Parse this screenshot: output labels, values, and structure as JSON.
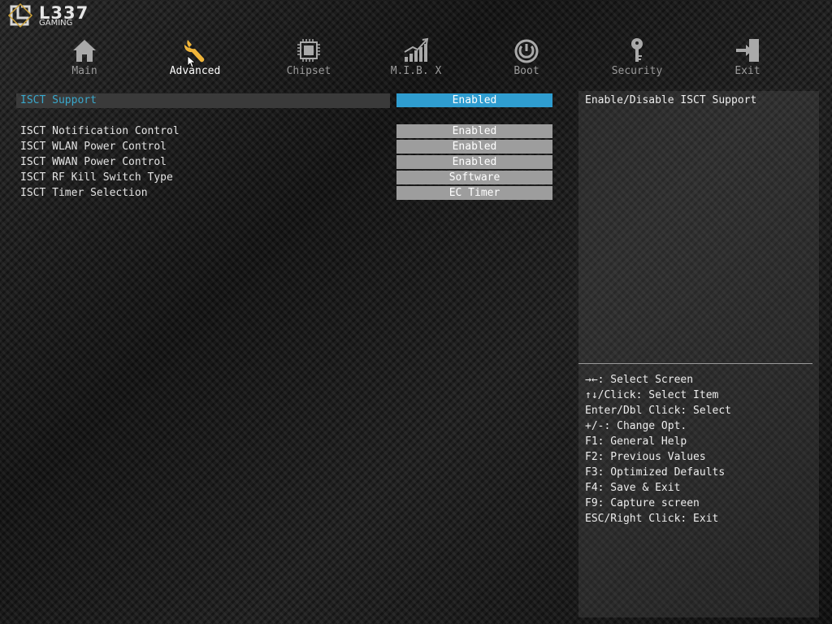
{
  "logo": {
    "brand": "L337",
    "sub": "GAMING"
  },
  "tabs": [
    {
      "label": "Main",
      "icon": "home-icon"
    },
    {
      "label": "Advanced",
      "icon": "wrench-icon",
      "active": true
    },
    {
      "label": "Chipset",
      "icon": "chip-icon"
    },
    {
      "label": "M.I.B. X",
      "icon": "chart-icon"
    },
    {
      "label": "Boot",
      "icon": "power-icon"
    },
    {
      "label": "Security",
      "icon": "key-icon"
    },
    {
      "label": "Exit",
      "icon": "exit-icon"
    }
  ],
  "settings": [
    {
      "name": "ISCT Support",
      "value": "Enabled",
      "selected": true
    },
    {
      "name": "ISCT Notification Control",
      "value": "Enabled"
    },
    {
      "name": "ISCT WLAN Power Control",
      "value": "Enabled"
    },
    {
      "name": "ISCT WWAN Power Control",
      "value": "Enabled"
    },
    {
      "name": "ISCT RF Kill Switch Type",
      "value": "Software"
    },
    {
      "name": "ISCT Timer Selection",
      "value": "EC Timer"
    }
  ],
  "help": {
    "description": "Enable/Disable ISCT Support",
    "keys": [
      "→←: Select Screen",
      "↑↓/Click: Select Item",
      "Enter/Dbl Click: Select",
      "+/-: Change Opt.",
      "F1: General Help",
      "F2: Previous Values",
      "F3: Optimized Defaults",
      "F4: Save & Exit",
      "F9: Capture screen",
      "ESC/Right Click: Exit"
    ]
  },
  "colors": {
    "accent": "#39a8cc",
    "selected_value_bg": "#2f9dd0",
    "value_bg": "#9d9d9d",
    "active_icon": "#f0b53a"
  }
}
